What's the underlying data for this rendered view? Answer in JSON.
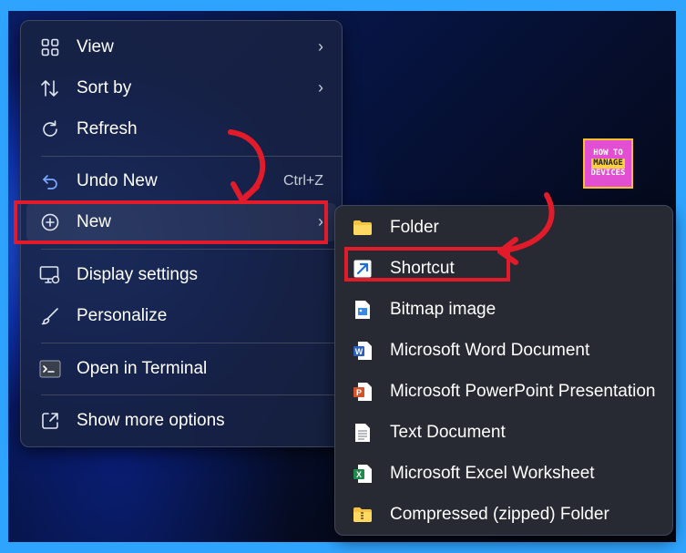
{
  "main_menu": {
    "items": [
      {
        "label": "View",
        "icon": "grid-icon",
        "chevron": "›"
      },
      {
        "label": "Sort by",
        "icon": "sort-arrows-icon",
        "chevron": "›"
      },
      {
        "label": "Refresh",
        "icon": "refresh-icon"
      },
      {
        "label": "Undo New",
        "icon": "undo-icon",
        "shortcut": "Ctrl+Z"
      },
      {
        "label": "New",
        "icon": "plus-circle-icon",
        "chevron": "›"
      },
      {
        "label": "Display settings",
        "icon": "display-settings-icon"
      },
      {
        "label": "Personalize",
        "icon": "brush-icon"
      },
      {
        "label": "Open in Terminal",
        "icon": "terminal-icon"
      },
      {
        "label": "Show more options",
        "icon": "more-options-icon"
      }
    ]
  },
  "sub_menu": {
    "items": [
      {
        "label": "Folder",
        "icon": "folder-icon"
      },
      {
        "label": "Shortcut",
        "icon": "shortcut-arrow-icon"
      },
      {
        "label": "Bitmap image",
        "icon": "bitmap-icon"
      },
      {
        "label": "Microsoft Word Document",
        "icon": "word-icon"
      },
      {
        "label": "Microsoft PowerPoint Presentation",
        "icon": "powerpoint-icon"
      },
      {
        "label": "Text Document",
        "icon": "text-document-icon"
      },
      {
        "label": "Microsoft Excel Worksheet",
        "icon": "excel-icon"
      },
      {
        "label": "Compressed (zipped) Folder",
        "icon": "zip-folder-icon"
      }
    ]
  },
  "logo": {
    "line1": "HOW TO",
    "line2": "MANAGE",
    "line3": "DEVICES"
  },
  "colors": {
    "highlight_box": "#e21b2a",
    "annotation_arrow": "#e21b2a",
    "frame": "#2fa4ff"
  }
}
